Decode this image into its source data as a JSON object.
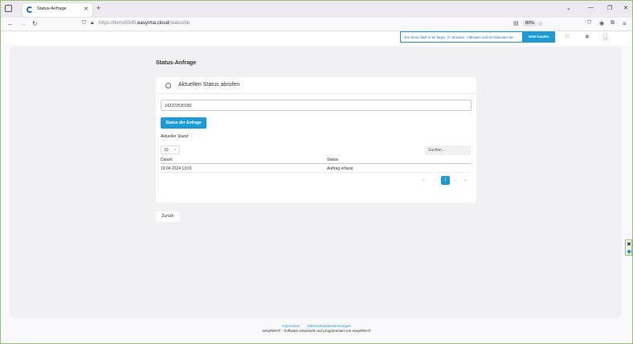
{
  "browser": {
    "tab_title": "Status-Anfrage",
    "tab_close": "✕",
    "new_tab": "+",
    "url_prefix": "https://demo5845.",
    "url_domain": "easyrma.cloud",
    "url_path": "/status/de",
    "zoom": "80%",
    "window_min": "⌄",
    "window_controls": [
      "—",
      "❐",
      "✕"
    ]
  },
  "header": {
    "banner_text": "Ihre Demo läuft in 16 Tagen, 17 Stunden, 7 Minuten und 46 Sekunden ab",
    "banner_button": "Jetzt kaufen"
  },
  "page": {
    "title": "Status-Anfrage",
    "card_title": "Aktuellen Status abrufen",
    "input_value": "142222530180",
    "primary_button": "Status der Anfrage",
    "current_state_label": "Aktueller Stand:",
    "page_size": "10",
    "search_placeholder": "Suchen...",
    "table": {
      "headers": [
        "Datum",
        "Status"
      ],
      "rows": [
        [
          "19.04.2024 13:01",
          "Auftrag erfasst"
        ]
      ]
    },
    "pagination": {
      "first": "«",
      "prev": "‹",
      "current": "1",
      "next": "›",
      "last": "»"
    },
    "back_button": "Zurück"
  },
  "footer": {
    "impressum": "Impressum",
    "datenschutz": "Datenschutzbestimmungen",
    "credit": "easyRMA® - Software entwickelt und programmiert von easyRMA®"
  },
  "colors": {
    "accent": "#1a9ad6",
    "frame": "#8fc46d"
  }
}
